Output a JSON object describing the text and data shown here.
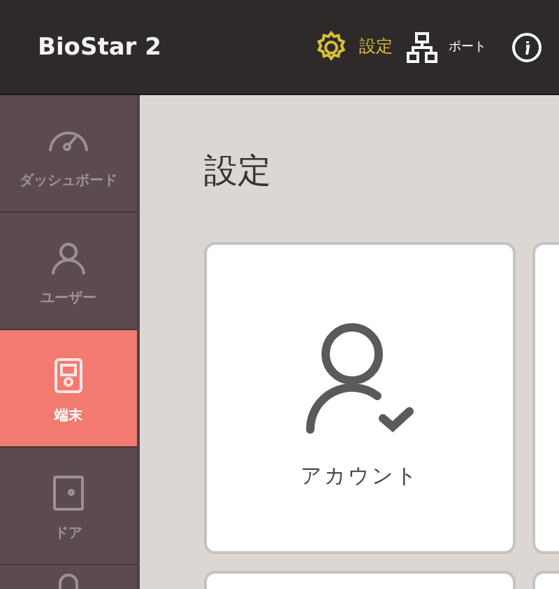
{
  "header": {
    "logo": "BioStar 2",
    "settings": {
      "label": "設定",
      "selected": true
    },
    "port": {
      "label": "ポート"
    }
  },
  "sidebar": {
    "items": [
      {
        "kind": "gauge",
        "label": "ダッシュボード",
        "selected": false
      },
      {
        "kind": "person",
        "label": "ユーザー",
        "selected": false
      },
      {
        "kind": "device",
        "label": "端末",
        "selected": true
      },
      {
        "kind": "door",
        "label": "ドア",
        "selected": false
      },
      {
        "kind": "lock",
        "selected": false
      }
    ]
  },
  "main": {
    "title": "設定",
    "cards": [
      {
        "kind": "account",
        "label": "アカウント"
      },
      {
        "kind": "blank"
      },
      {
        "kind": "blank"
      },
      {
        "kind": "blank"
      }
    ]
  }
}
